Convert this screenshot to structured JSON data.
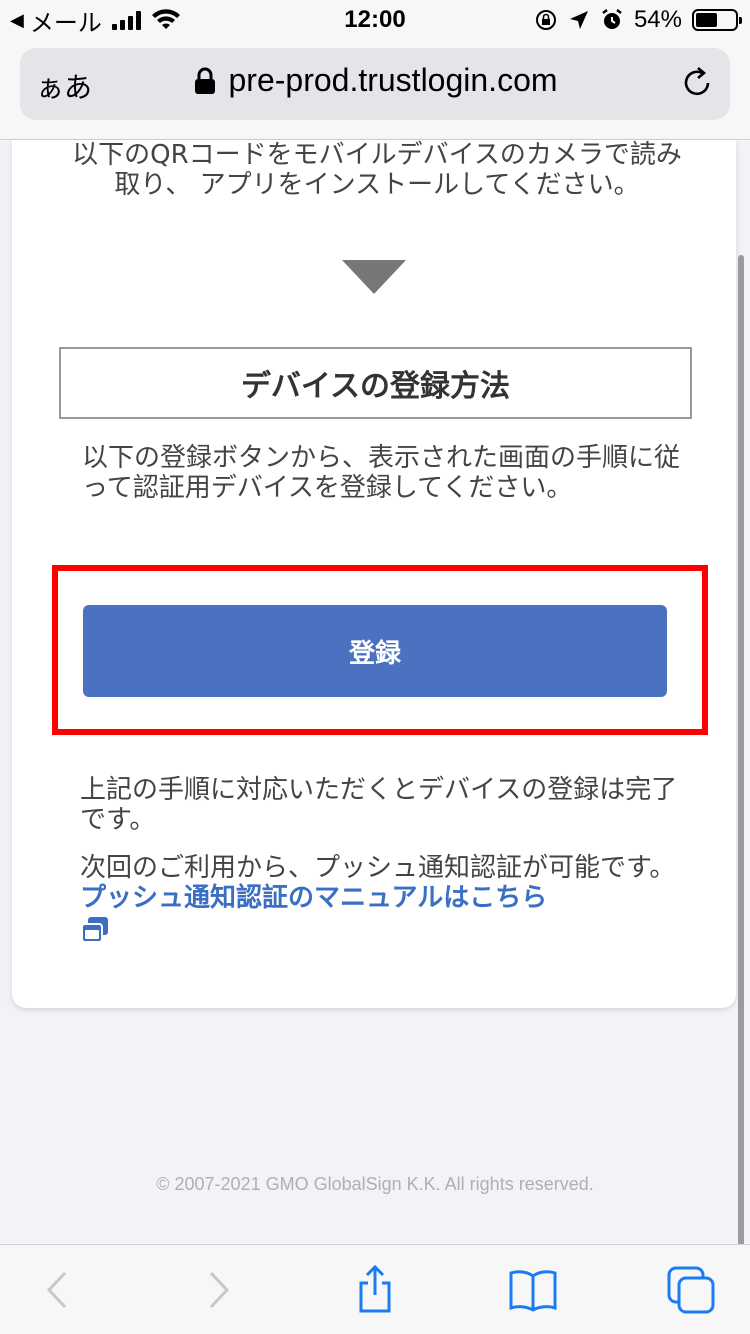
{
  "status_bar": {
    "back_app": "メール",
    "time": "12:00",
    "battery": "54%",
    "battery_level": 0.54
  },
  "address_bar": {
    "text_size_label": "ぁあ",
    "url": "pre-prod.trustlogin.com"
  },
  "content": {
    "qr_instruction": "以下のQRコードをモバイルデバイスのカメラで読み取り、 アプリをインストールしてください。",
    "section_title": "デバイスの登録方法",
    "register_instruction": "以下の登録ボタンから、表示された画面の手順に従って認証用デバイスを登録してください。",
    "register_button": "登録",
    "complete_text": "上記の手順に対応いただくとデバイスの登録は完了です。",
    "next_text": "次回のご利用から、プッシュ通知認証が可能です。",
    "manual_link": "プッシュ通知認証のマニュアルはこちら"
  },
  "footer": {
    "copyright": "© 2007-2021 GMO GlobalSign K.K. All rights reserved."
  },
  "toolbar": {
    "icons": [
      "back-icon",
      "forward-icon",
      "share-icon",
      "bookmarks-icon",
      "tabs-icon"
    ]
  },
  "colors": {
    "button": "#4a72c0",
    "highlight": "#ff0000",
    "link": "#3b6fc4",
    "ios_blue": "#1a7cf5"
  }
}
